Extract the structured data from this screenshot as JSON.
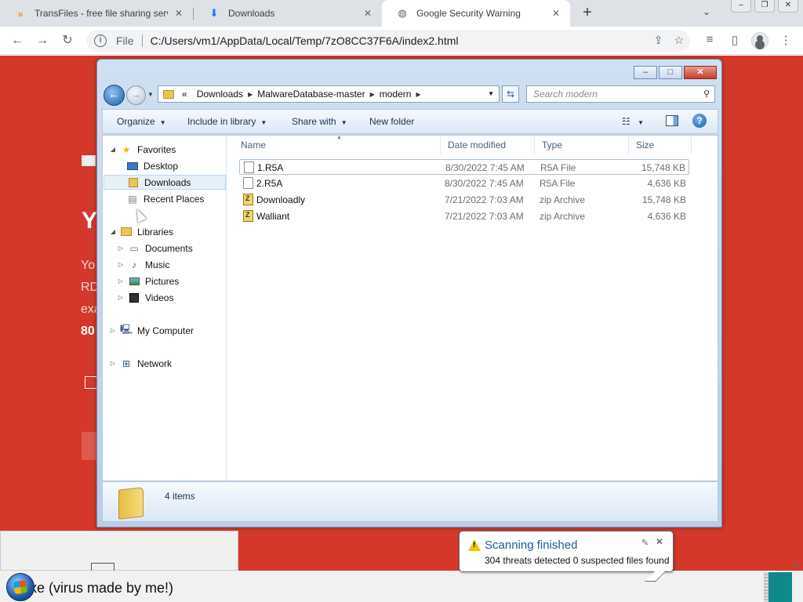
{
  "browser": {
    "tabs": [
      {
        "title": "TransFiles - free file sharing service",
        "icon": "transfiles-chevron-icon",
        "active": false
      },
      {
        "title": "Downloads",
        "icon": "download-icon",
        "active": false
      },
      {
        "title": "Google Security Warning",
        "icon": "globe-icon",
        "active": true
      }
    ],
    "new_tab_label": "+",
    "omnibox": {
      "scheme_label": "File",
      "url": "C:/Users/vm1/AppData/Local/Temp/7zO8CC37F6A/index2.html"
    }
  },
  "page": {
    "background_color": "#d3382b",
    "peek_texts": [
      "Y",
      "Yo",
      "RD",
      "exa",
      "80"
    ]
  },
  "explorer": {
    "breadcrumb": [
      "Downloads",
      "MalwareDatabase-master",
      "modern"
    ],
    "breadcrumb_overflow": "«",
    "search_placeholder": "Search modern",
    "commands": {
      "organize": "Organize",
      "include_in_library": "Include in library",
      "share_with": "Share with",
      "new_folder": "New folder"
    },
    "nav": {
      "favorites": "Favorites",
      "desktop": "Desktop",
      "downloads": "Downloads",
      "recent_places": "Recent Places",
      "libraries": "Libraries",
      "documents": "Documents",
      "music": "Music",
      "pictures": "Pictures",
      "videos": "Videos",
      "my_computer": "My Computer",
      "network": "Network"
    },
    "columns": {
      "name": "Name",
      "date_modified": "Date modified",
      "type": "Type",
      "size": "Size"
    },
    "files": [
      {
        "name": "1.R5A",
        "date": "8/30/2022 7:45 AM",
        "type": "R5A File",
        "size": "15,748 KB",
        "icon": "document-icon"
      },
      {
        "name": "2.R5A",
        "date": "8/30/2022 7:45 AM",
        "type": "R5A File",
        "size": "4,636 KB",
        "icon": "document-icon"
      },
      {
        "name": "Downloadly",
        "date": "7/21/2022 7:03 AM",
        "type": "zip Archive",
        "size": "15,748 KB",
        "icon": "zip-icon"
      },
      {
        "name": "Walliant",
        "date": "7/21/2022 7:03 AM",
        "type": "zip Archive",
        "size": "4,636 KB",
        "icon": "zip-icon"
      }
    ],
    "item_count": "4 items"
  },
  "notification": {
    "title": "Scanning finished",
    "text": "304 threats detected 0 suspected files found"
  },
  "taskbar": {
    "text": "xe (virus made by me!)"
  }
}
